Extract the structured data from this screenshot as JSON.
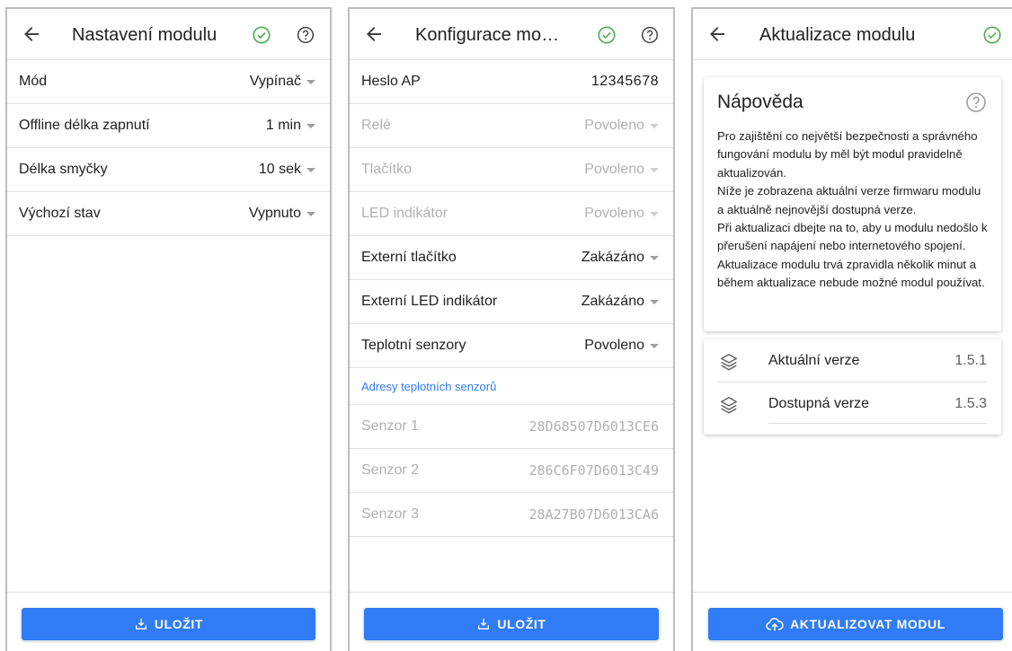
{
  "panel1": {
    "title": "Nastavení modulu",
    "rows": [
      {
        "label": "Mód",
        "value": "Vypínač"
      },
      {
        "label": "Offline délka zapnutí",
        "value": "1 min"
      },
      {
        "label": "Délka smyčky",
        "value": "10 sek"
      },
      {
        "label": "Výchozí stav",
        "value": "Vypnuto"
      }
    ],
    "save_label": "ULOŽIT"
  },
  "panel2": {
    "title": "Konfigurace mo…",
    "password": {
      "label": "Heslo AP",
      "value": "12345678"
    },
    "rows": [
      {
        "label": "Relé",
        "value": "Povoleno"
      },
      {
        "label": "Tlačítko",
        "value": "Povoleno"
      },
      {
        "label": "LED indikátor",
        "value": "Povoleno"
      },
      {
        "label": "Externí tlačítko",
        "value": "Zakázáno"
      },
      {
        "label": "Externí LED indikátor",
        "value": "Zakázáno"
      },
      {
        "label": "Teplotní senzory",
        "value": "Povoleno"
      }
    ],
    "sensors_link": "Adresy teplotních senzorů",
    "sensors": [
      {
        "label": "Senzor 1",
        "value": "28D68507D6013CE6"
      },
      {
        "label": "Senzor 2",
        "value": "286C6F07D6013C49"
      },
      {
        "label": "Senzor 3",
        "value": "28A27B07D6013CA6"
      }
    ],
    "save_label": "ULOŽIT"
  },
  "panel3": {
    "title": "Aktualizace modulu",
    "help_title": "Nápověda",
    "help_text": "Pro zajištění co největší bezpečnosti a správného fungování modulu by měl být modul pravidelně aktualizován.\nNíže je zobrazena aktuální verze firmwaru modulu a aktuálně nejnovější dostupná verze.\nPři aktualizaci dbejte na to, aby u modulu nedošlo k přerušení napájení nebo internetového spojení.\nAktualizace modulu trvá zpravidla několik minut a během aktualizace nebude možné modul používat.",
    "current_version": {
      "label": "Aktuální verze",
      "value": "1.5.1"
    },
    "available_version": {
      "label": "Dostupná verze",
      "value": "1.5.3"
    },
    "update_label": "AKTUALIZOVAT MODUL"
  },
  "colors": {
    "accent": "#2f7cf6",
    "ok": "#4caf50",
    "disabled": "#b0b0b0"
  },
  "icons": [
    "arrow-back-icon",
    "check-circle-icon",
    "help-circle-icon",
    "chevron-down-icon",
    "save-icon",
    "layers-icon",
    "cloud-upload-icon"
  ]
}
